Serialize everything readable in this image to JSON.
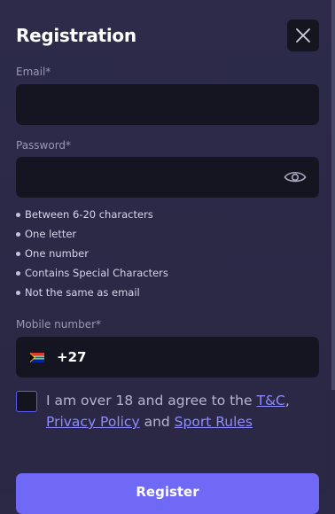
{
  "modal": {
    "title": "Registration",
    "close_icon": "close-icon"
  },
  "email": {
    "label": "Email*",
    "value": "",
    "placeholder": ""
  },
  "password": {
    "label": "Password*",
    "value": "",
    "placeholder": "",
    "toggle_icon": "eye-icon",
    "rules": [
      "Between 6-20 characters",
      "One letter",
      "One number",
      "Contains Special Characters",
      "Not the same as email"
    ]
  },
  "mobile": {
    "label": "Mobile number*",
    "country_flag": "south-africa-flag-icon",
    "dial_code": "+27"
  },
  "terms": {
    "checked": false,
    "prefix": "I am over 18 and agree to the ",
    "tc_link": "T&C",
    "comma": ",",
    "privacy_link": "Privacy Policy",
    "and": " and ",
    "sport_rules_link": "Sport Rules"
  },
  "register_button_label": "Register",
  "colors": {
    "background": "#2b2945",
    "input_background": "#151521",
    "accent": "#6f69f5",
    "link": "#8f8cff"
  }
}
